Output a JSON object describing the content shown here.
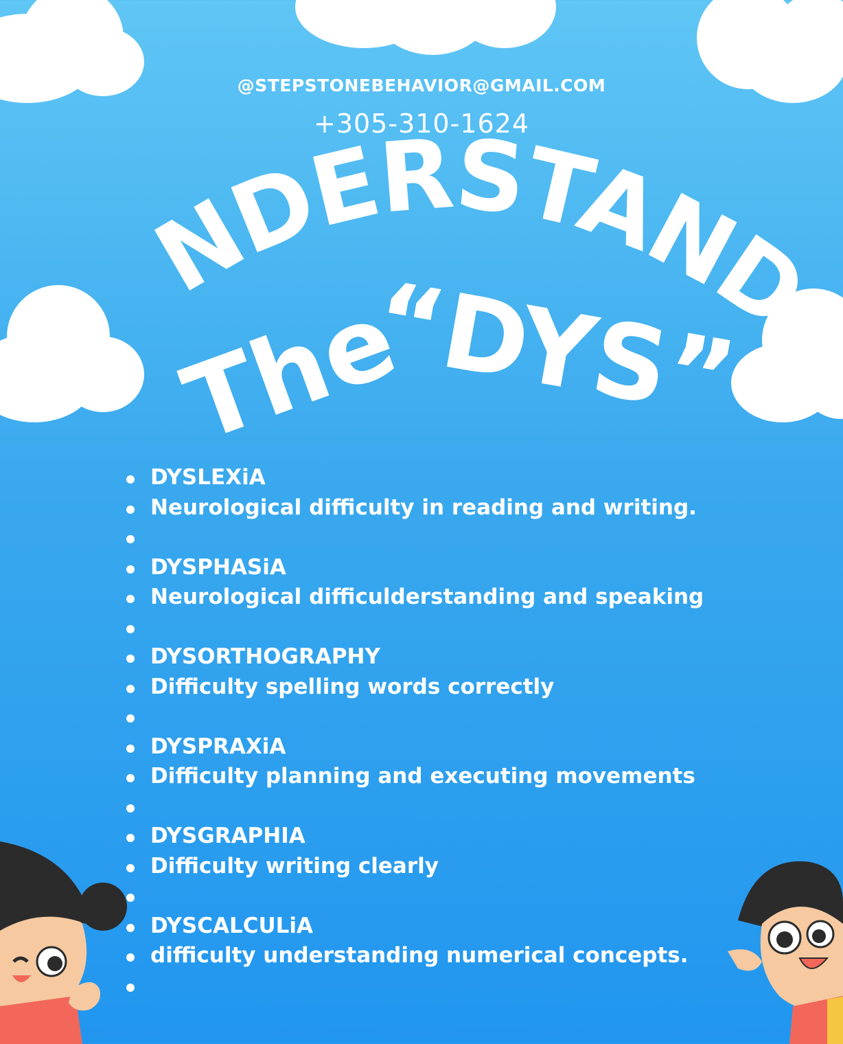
{
  "contact": {
    "email": "@STEPSTONEBEHAVIOR@GMAIL.COM",
    "phone": "+305-310-1624"
  },
  "headline": {
    "line1": "UNDERSTAND",
    "line2_the": "The",
    "line2_dys": "“DYS”"
  },
  "list": [
    "DYSLEXiA",
    "Neurological difficulty in reading and writing.",
    "",
    "DYSPHASiA",
    "Neurological difficulderstanding and speaking",
    "",
    "DYSORTHOGRAPHY",
    "Difficulty spelling words correctly",
    "",
    "DYSPRAXiA",
    "Difficulty planning and executing movements",
    "",
    "DYSGRAPHIA",
    "Difficulty writing clearly",
    "",
    "DYSCALCULiA",
    "difficulty understanding numerical concepts.",
    ""
  ],
  "colors": {
    "sky_top": "#5fc6f5",
    "sky_bottom": "#2196ef",
    "text": "#ffffff",
    "cloud": "#ffffff",
    "kid_hair": "#2b2b2b",
    "kid_skin": "#f6c9a0",
    "kid_shirt_red": "#f2675a",
    "kid_shirt_yellow": "#f7c640"
  },
  "icons": [
    "cloud-icon",
    "girl-cartoon-icon",
    "boy-cartoon-icon"
  ]
}
